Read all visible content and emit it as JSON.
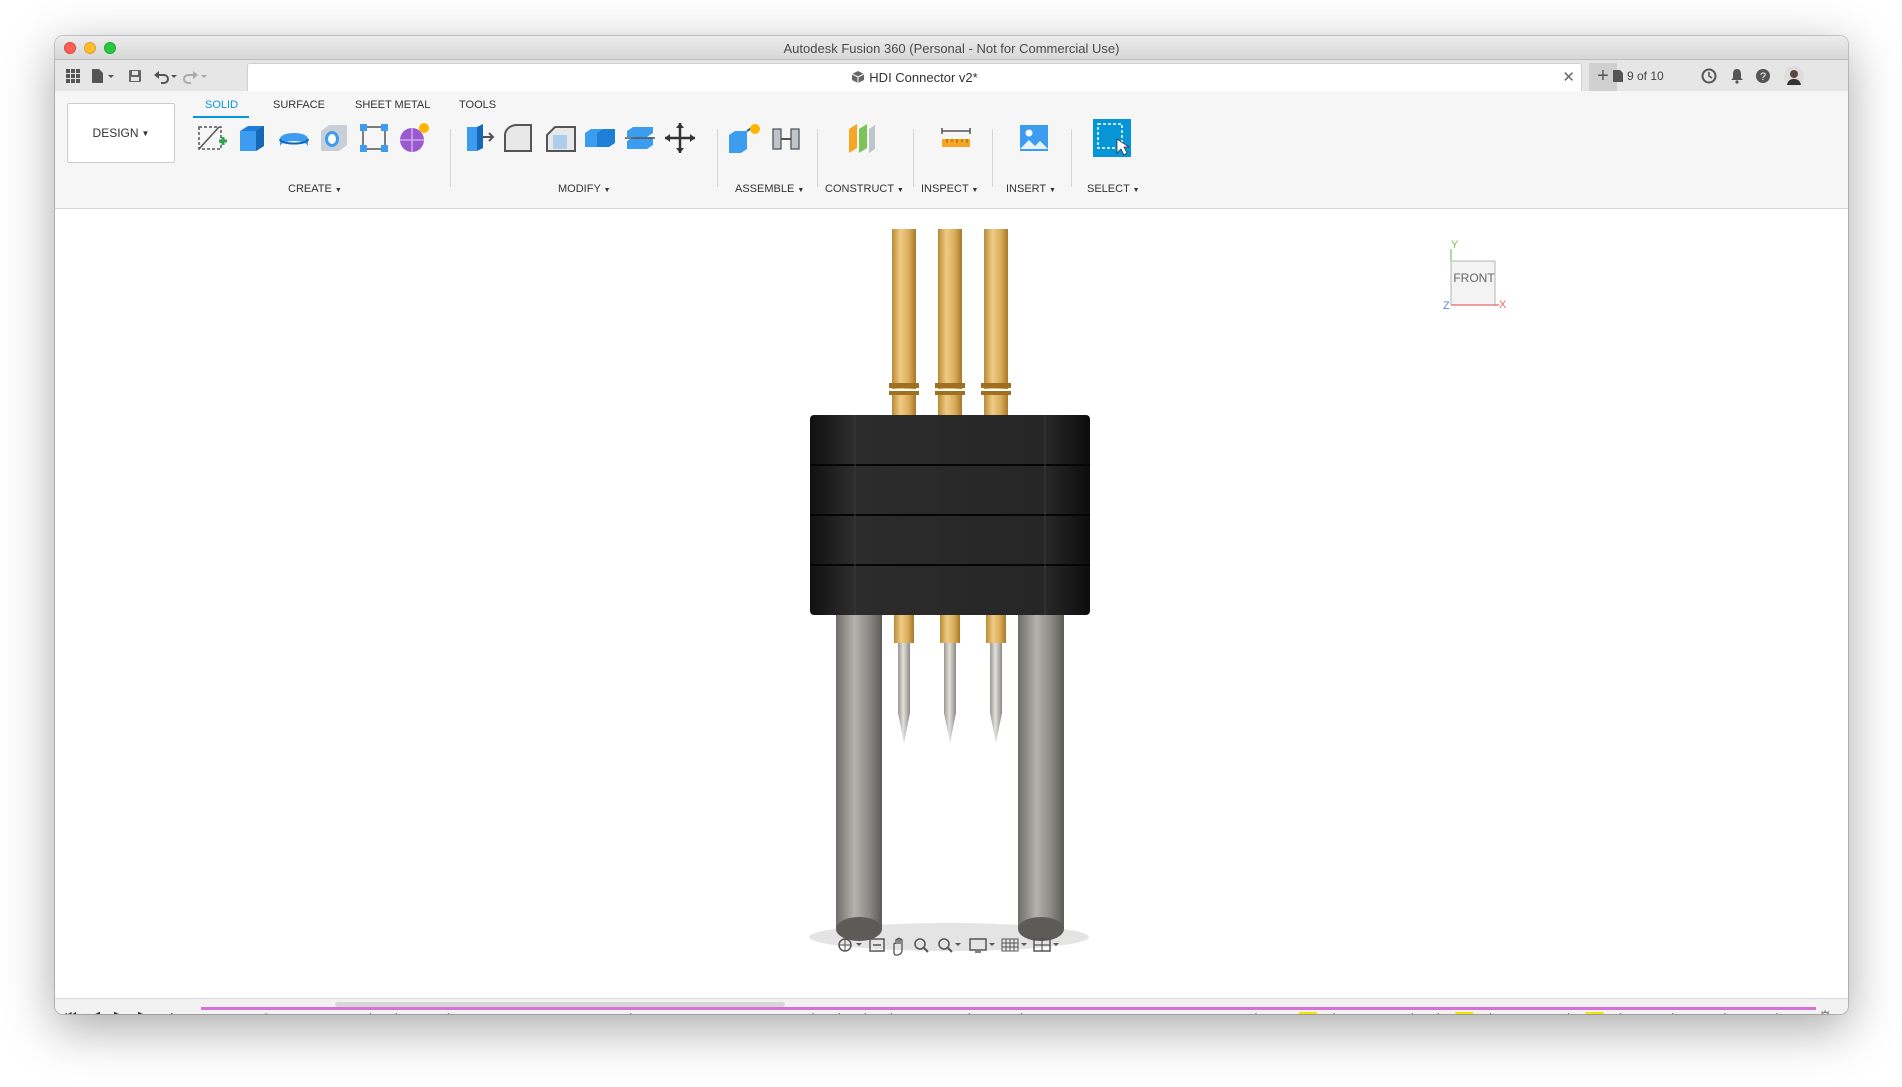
{
  "window": {
    "title": "Autodesk Fusion 360 (Personal - Not for Commercial Use)"
  },
  "appbar": {
    "document_title": "HDI Connector v2*",
    "version_badge": "9 of 10",
    "icons": [
      "data-panel-grid-icon",
      "file-menu-icon",
      "save-icon",
      "undo-icon",
      "redo-icon",
      "close-tab-icon",
      "new-tab-plus-icon",
      "version-icon",
      "job-status-icon",
      "notifications-bell-icon",
      "help-icon",
      "user-avatar"
    ]
  },
  "ribbon": {
    "workspace": "DESIGN",
    "tabs": [
      {
        "label": "SOLID",
        "active": true
      },
      {
        "label": "SURFACE",
        "active": false
      },
      {
        "label": "SHEET METAL",
        "active": false
      },
      {
        "label": "TOOLS",
        "active": false
      }
    ],
    "groups": [
      {
        "label": "CREATE",
        "tools": [
          "create-sketch-icon",
          "extrude-icon",
          "revolve-icon",
          "hole-icon",
          "rectangular-pattern-icon",
          "create-form-icon"
        ]
      },
      {
        "label": "MODIFY",
        "tools": [
          "press-pull-icon",
          "fillet-icon",
          "chamfer-icon",
          "combine-icon",
          "split-body-icon",
          "move-copy-icon"
        ]
      },
      {
        "label": "ASSEMBLE",
        "tools": [
          "new-component-icon",
          "joint-icon"
        ]
      },
      {
        "label": "CONSTRUCT",
        "tools": [
          "offset-plane-icon"
        ]
      },
      {
        "label": "INSPECT",
        "tools": [
          "measure-icon"
        ]
      },
      {
        "label": "INSERT",
        "tools": [
          "insert-image-icon"
        ]
      },
      {
        "label": "SELECT",
        "tools": [
          "select-icon"
        ]
      }
    ]
  },
  "viewport": {
    "viewcube": {
      "face_label": "FRONT",
      "axis_x": "X",
      "axis_y": "Y",
      "axis_z": "Z"
    },
    "model_colors": {
      "housing": "#222222",
      "pins": "#d9b063",
      "posts": "#8c8a85",
      "shadow": "#e4e4e4"
    },
    "nav_icons": [
      "orbit-icon",
      "look-at-icon",
      "pan-hand-icon",
      "zoom-icon",
      "zoom-window-icon",
      "display-settings-icon",
      "grid-snap-icon",
      "viewports-icon"
    ]
  },
  "timeline": {
    "controls": [
      "go-to-start-icon",
      "step-back-icon",
      "play-icon",
      "step-forward-icon",
      "go-to-end-icon"
    ],
    "track_color": "#d96fd9",
    "features": [
      "sketch",
      "sketch",
      "move",
      "extrude",
      "joint",
      "extrude",
      "move",
      "move",
      "extrude",
      "move",
      "extrude",
      "fillet",
      "fillet",
      "extrude",
      "extrude",
      "extrude",
      "move",
      "extrude",
      "fillet",
      "extrude",
      "extrude",
      "fillet",
      "chamfer",
      "move",
      "move",
      "move",
      "move",
      "extrude",
      "extrude",
      "move",
      "joint",
      "move",
      "extrude",
      "fillet",
      "extrude",
      "fillet",
      "fillet",
      "extrude",
      "extrude",
      "extrude",
      "move",
      "extrude",
      "sketch-highlight",
      "move",
      "extrude",
      "extrude",
      "move",
      "move",
      "sketch-highlight",
      "move",
      "extrude",
      "extrude",
      "move",
      "sketch-highlight",
      "move",
      "joint",
      "move",
      "joint",
      "move",
      "joint",
      "move",
      "joint"
    ]
  }
}
